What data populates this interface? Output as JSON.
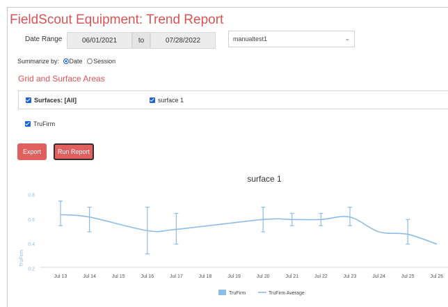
{
  "header": {
    "title": "FieldScout Equipment: Trend Report"
  },
  "date_range": {
    "label": "Date Range",
    "start": "06/01/2021",
    "separator": "to",
    "end": "07/28/2022"
  },
  "test_select": {
    "value": "manualtest1"
  },
  "summarize": {
    "label": "Summarize by:",
    "options": [
      "Date",
      "Session"
    ],
    "selected": "Date"
  },
  "section": {
    "title": "Grid and Surface Areas"
  },
  "filters": {
    "surfaces_all": "Surfaces: [All]",
    "surface_1": "surface 1",
    "trufirm": "TruFirm"
  },
  "buttons": {
    "export": "Export",
    "run_report": "Run Report"
  },
  "colors": {
    "accent": "#d95454",
    "line": "#8bbde8",
    "button": "#e06060",
    "checkbox": "#1e63d6"
  },
  "chart_data": {
    "type": "line",
    "title": "surface 1",
    "ylabel": "TruFirm",
    "ylim": [
      0.2,
      0.8
    ],
    "yticks": [
      "0.8",
      "0.6",
      "0.4",
      "0.2"
    ],
    "categories": [
      "Jul 13",
      "Jul 14",
      "Jul 15",
      "Jul 16",
      "Jul 17",
      "Jul 18",
      "Jul 19",
      "Jul 20",
      "Jul 21",
      "Jul 22",
      "Jul 23",
      "Jul 24",
      "Jul 25",
      "Jul 26"
    ],
    "series": [
      {
        "name": "TruFirm",
        "type": "error-bar",
        "points": [
          {
            "x": "Jul 13",
            "low": 0.55,
            "high": 0.75
          },
          {
            "x": "Jul 14",
            "low": 0.5,
            "high": 0.7
          },
          {
            "x": "Jul 16",
            "low": 0.32,
            "high": 0.7
          },
          {
            "x": "Jul 17",
            "low": 0.4,
            "high": 0.65
          },
          {
            "x": "Jul 20",
            "low": 0.5,
            "high": 0.7
          },
          {
            "x": "Jul 21",
            "low": 0.55,
            "high": 0.65
          },
          {
            "x": "Jul 22",
            "low": 0.55,
            "high": 0.65
          },
          {
            "x": "Jul 23",
            "low": 0.55,
            "high": 0.7
          },
          {
            "x": "Jul 25",
            "low": 0.4,
            "high": 0.6
          }
        ]
      },
      {
        "name": "TruFirm Average",
        "type": "line",
        "points": [
          {
            "x": "Jul 13",
            "y": 0.64
          },
          {
            "x": "Jul 14",
            "y": 0.62
          },
          {
            "x": "Jul 16",
            "y": 0.51
          },
          {
            "x": "Jul 17",
            "y": 0.52
          },
          {
            "x": "Jul 20",
            "y": 0.6
          },
          {
            "x": "Jul 21",
            "y": 0.6
          },
          {
            "x": "Jul 22",
            "y": 0.6
          },
          {
            "x": "Jul 23",
            "y": 0.62
          },
          {
            "x": "Jul 24",
            "y": 0.5
          },
          {
            "x": "Jul 25",
            "y": 0.48
          },
          {
            "x": "Jul 26",
            "y": 0.4
          }
        ]
      }
    ],
    "legend": [
      "TruFirm",
      "TruFirm Average"
    ],
    "legend_position": "bottom",
    "grid": false
  }
}
